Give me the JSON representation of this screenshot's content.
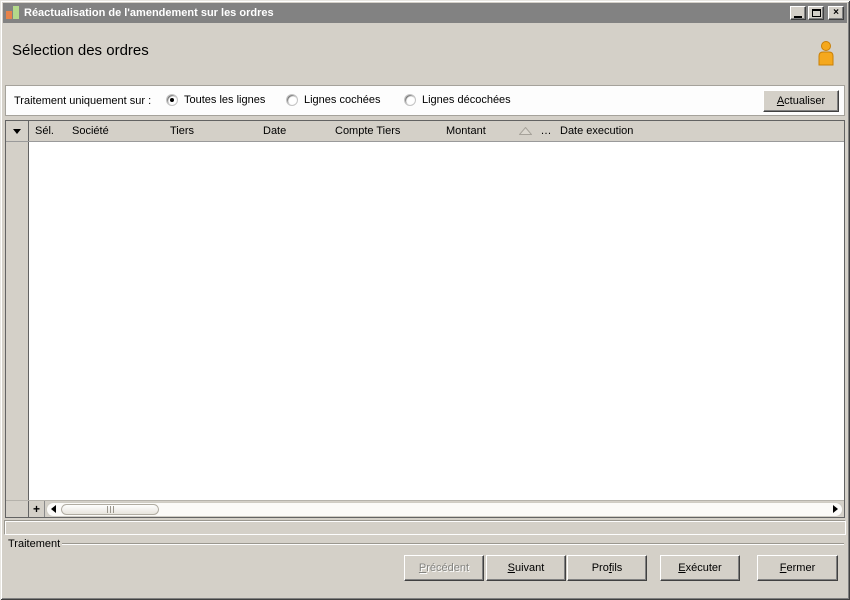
{
  "window": {
    "title": "Réactualisation de l'amendement sur les ordres"
  },
  "header": {
    "title": "Sélection des ordres"
  },
  "filter": {
    "label": "Traitement uniquement sur :",
    "options": [
      {
        "label": "Toutes les lignes",
        "selected": true
      },
      {
        "label": "Lignes cochées",
        "selected": false
      },
      {
        "label": "Lignes décochées",
        "selected": false
      }
    ],
    "refresh_button": {
      "label": "Actualiser",
      "mnemonic": 0,
      "enabled": true
    }
  },
  "table": {
    "columns": [
      "Sél.",
      "Société",
      "Tiers",
      "Date",
      "Compte Tiers",
      "Montant",
      "…",
      "Date execution"
    ],
    "rows": []
  },
  "footer": {
    "group_label": "Traitement",
    "buttons": [
      {
        "label": "Précédent",
        "mnemonic": 0,
        "enabled": false
      },
      {
        "label": "Suivant",
        "mnemonic": 0,
        "enabled": true
      },
      {
        "label": "Profils",
        "mnemonic": 3,
        "enabled": true
      },
      {
        "label": "Exécuter",
        "mnemonic": 0,
        "enabled": true
      },
      {
        "label": "Fermer",
        "mnemonic": 0,
        "enabled": true
      }
    ]
  },
  "icons": {
    "app": "bar-chart-icon",
    "user": "user-silhouette-icon",
    "gutter_header": "dropdown-arrow-icon",
    "sort": "sort-asc-icon",
    "scroll_add": "plus-icon",
    "scroll_left": "arrow-left-icon",
    "scroll_right": "arrow-right-icon"
  },
  "colors": {
    "window_bg": "#d4d0c8",
    "titlebar_bg": "#828282",
    "titlebar_text": "#ffffff",
    "filter_band_bg": "#fdfdfd",
    "grid_body_bg": "#ffffff",
    "icon_orange": "#f5a81d",
    "icon_bar_orange": "#e8834a",
    "icon_bar_green": "#b3d98a"
  }
}
